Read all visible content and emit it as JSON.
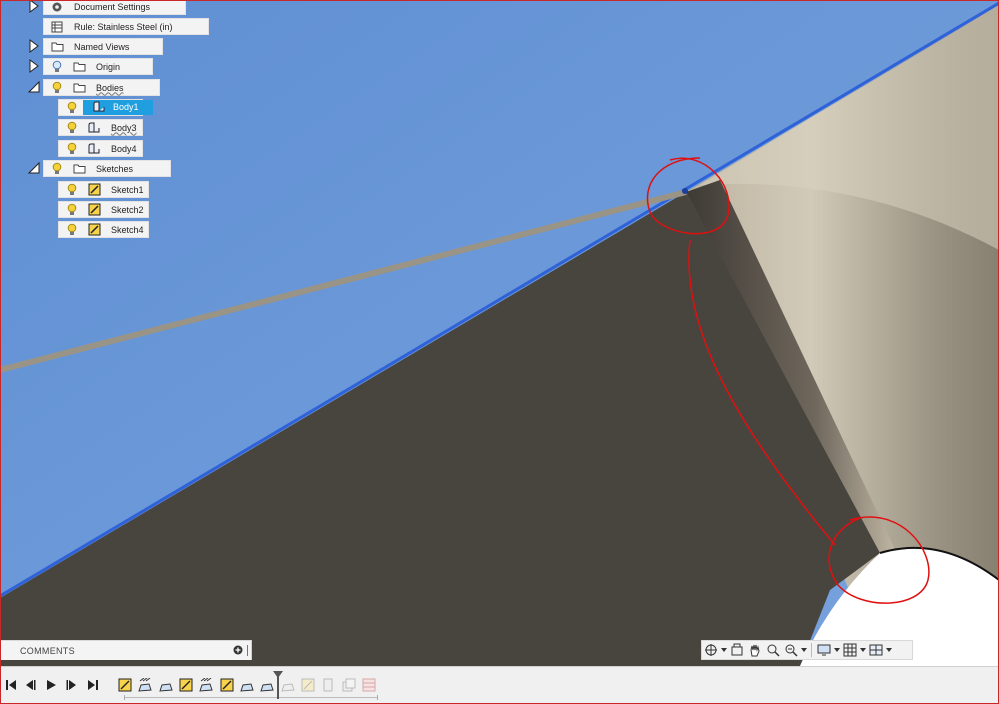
{
  "browser": {
    "items": [
      {
        "label": "Document Settings",
        "icon": "gear-icon"
      },
      {
        "label": "Rule: Stainless Steel (in)",
        "icon": "sheet-metal-rule-icon"
      },
      {
        "label": "Named Views",
        "icon": "folder-icon"
      },
      {
        "label": "Origin",
        "icon": "folder-icon"
      },
      {
        "label": "Bodies",
        "icon": "folder-icon"
      },
      {
        "label": "Body1",
        "icon": "sheet-body-icon"
      },
      {
        "label": "Body3",
        "icon": "sheet-body-icon"
      },
      {
        "label": "Body4",
        "icon": "sheet-body-icon"
      },
      {
        "label": "Sketches",
        "icon": "folder-icon"
      },
      {
        "label": "Sketch1",
        "icon": "sketch-icon"
      },
      {
        "label": "Sketch2",
        "icon": "sketch-icon"
      },
      {
        "label": "Sketch4",
        "icon": "sketch-icon"
      }
    ]
  },
  "comments": {
    "title": "COMMENTS"
  },
  "colors": {
    "selection": "#1f9ee0",
    "sky_blue": "#6b98d6",
    "dark_face": "#48443e",
    "tan_face": "#c9c0ae",
    "annotation_red": "#e01010"
  },
  "navbar": {
    "icons": [
      "orbit-icon",
      "look-at-icon",
      "pan-icon",
      "zoom-window-icon",
      "fit-icon",
      "display-settings-icon",
      "grid-icon",
      "viewports-icon"
    ]
  },
  "timeline": {
    "controls": [
      "go-to-start-icon",
      "step-back-icon",
      "play-icon",
      "step-forward-icon",
      "go-to-end-icon"
    ],
    "features": [
      "sketch",
      "flange",
      "flange",
      "sketch",
      "flange",
      "sketch",
      "flange",
      "flange",
      "suppressed",
      "suppressed-sketch",
      "suppressed",
      "suppressed",
      "suppressed-group"
    ]
  }
}
